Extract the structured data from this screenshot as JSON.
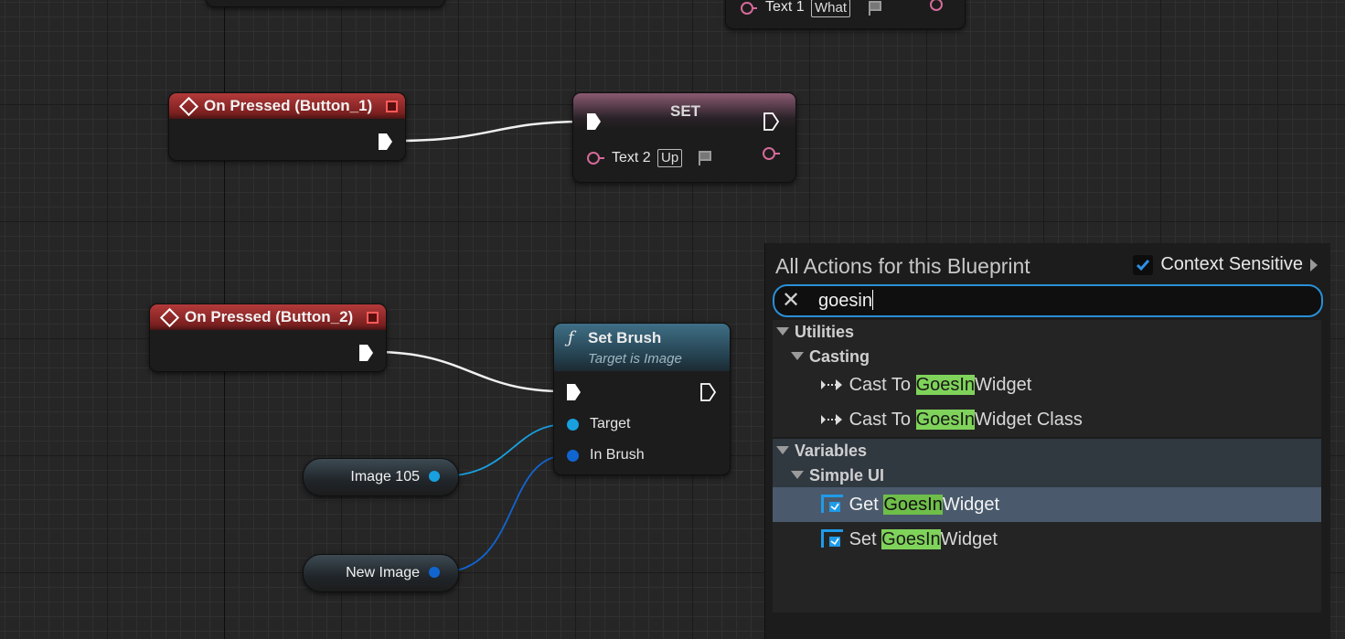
{
  "graph": {
    "event1": {
      "title": "On Pressed (Button_1)"
    },
    "event2": {
      "title": "On Pressed (Button_2)"
    },
    "set_node": {
      "title": "SET",
      "pin_label": "Text 2",
      "pin_tag": "Up"
    },
    "partial_node": {
      "pin_label": "Text 1",
      "pin_tag": "What"
    },
    "set_brush": {
      "title": "Set Brush",
      "subtitle": "Target is Image",
      "pin_target": "Target",
      "pin_brush": "In Brush"
    },
    "var_image105": {
      "label": "Image 105"
    },
    "var_newimage": {
      "label": "New Image"
    },
    "colors": {
      "event_header": "#b33a3a",
      "pin_text": "#d56a9a",
      "pin_object": "#18a0e0",
      "pin_brush": "#1065d0"
    }
  },
  "action_menu": {
    "title": "All Actions for this Blueprint",
    "context_sensitive_label": "Context Sensitive",
    "context_sensitive_checked": true,
    "search_value": "goesin",
    "highlight_color": "#7fd35a",
    "tree": [
      {
        "level": 0,
        "label": "Utilities"
      },
      {
        "level": 1,
        "label": "Casting"
      },
      {
        "level": 2,
        "icon": "cast-icon",
        "pre": "Cast To ",
        "match": "GoesIn",
        "post": "Widget"
      },
      {
        "level": 2,
        "icon": "cast-icon",
        "pre": "Cast To ",
        "match": "GoesIn",
        "post": "Widget Class"
      },
      {
        "level": 0,
        "label": "Variables"
      },
      {
        "level": 1,
        "label": "Simple UI"
      },
      {
        "level": 2,
        "icon": "get-variable-icon",
        "pre": "Get ",
        "match": "GoesIn",
        "post": "Widget",
        "selected": true
      },
      {
        "level": 2,
        "icon": "set-variable-icon",
        "pre": "Set ",
        "match": "GoesIn",
        "post": "Widget"
      }
    ]
  }
}
